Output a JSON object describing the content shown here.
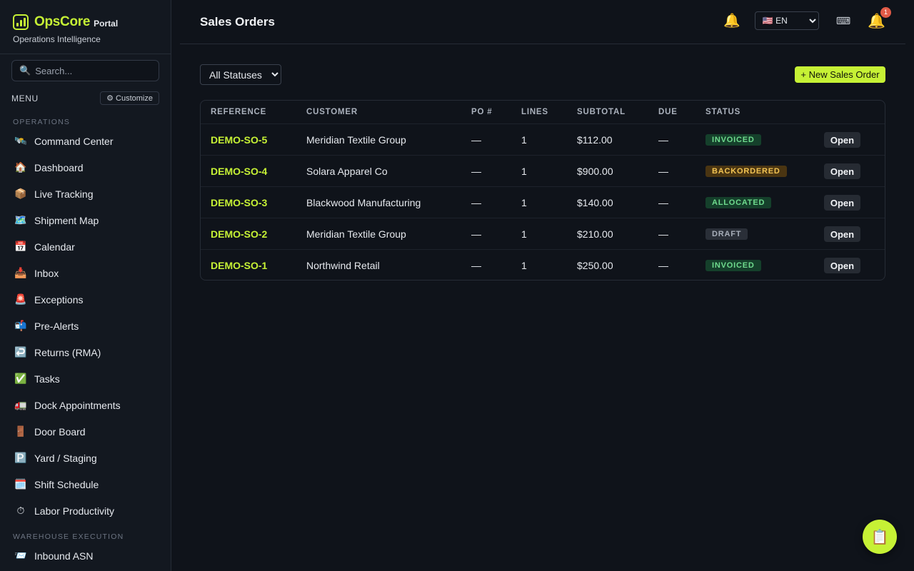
{
  "brand": {
    "name": "OpsCore",
    "portal": "Portal",
    "subtitle": "Operations Intelligence"
  },
  "search": {
    "placeholder": "Search..."
  },
  "menu": {
    "label": "MENU",
    "customize_label": "⚙ Customize"
  },
  "sections": [
    {
      "label": "OPERATIONS",
      "items": [
        {
          "label": "Command Center",
          "icon": "🛰️"
        },
        {
          "label": "Dashboard",
          "icon": "🏠"
        },
        {
          "label": "Live Tracking",
          "icon": "📦"
        },
        {
          "label": "Shipment Map",
          "icon": "🗺️"
        },
        {
          "label": "Calendar",
          "icon": "📅"
        },
        {
          "label": "Inbox",
          "icon": "📥"
        },
        {
          "label": "Exceptions",
          "icon": "🚨"
        },
        {
          "label": "Pre-Alerts",
          "icon": "📬"
        },
        {
          "label": "Returns (RMA)",
          "icon": "↩️"
        },
        {
          "label": "Tasks",
          "icon": "✅"
        },
        {
          "label": "Dock Appointments",
          "icon": "🚛"
        },
        {
          "label": "Door Board",
          "icon": "🚪"
        },
        {
          "label": "Yard / Staging",
          "icon": "🅿️"
        },
        {
          "label": "Shift Schedule",
          "icon": "🗓️"
        },
        {
          "label": "Labor Productivity",
          "icon": "⏱"
        }
      ]
    },
    {
      "label": "WAREHOUSE EXECUTION",
      "items": [
        {
          "label": "Inbound ASN",
          "icon": "📨"
        }
      ]
    }
  ],
  "header": {
    "title": "Sales Orders",
    "language": "🇺🇸 EN",
    "keyboard_icon": "⌨",
    "notification_count": "1"
  },
  "filter": {
    "selected": "All Statuses"
  },
  "new_button": {
    "label": "+ New Sales Order"
  },
  "table": {
    "columns": [
      "REFERENCE",
      "CUSTOMER",
      "PO #",
      "LINES",
      "SUBTOTAL",
      "DUE",
      "STATUS"
    ],
    "open_label": "Open",
    "rows": [
      {
        "reference": "DEMO-SO-5",
        "customer": "Meridian Textile Group",
        "po": "—",
        "lines": "1",
        "subtotal": "$112.00",
        "due": "—",
        "status": "INVOICED",
        "status_key": "invoiced"
      },
      {
        "reference": "DEMO-SO-4",
        "customer": "Solara Apparel Co",
        "po": "—",
        "lines": "1",
        "subtotal": "$900.00",
        "due": "—",
        "status": "BACKORDERED",
        "status_key": "backordered"
      },
      {
        "reference": "DEMO-SO-3",
        "customer": "Blackwood Manufacturing",
        "po": "—",
        "lines": "1",
        "subtotal": "$140.00",
        "due": "—",
        "status": "ALLOCATED",
        "status_key": "allocated"
      },
      {
        "reference": "DEMO-SO-2",
        "customer": "Meridian Textile Group",
        "po": "—",
        "lines": "1",
        "subtotal": "$210.00",
        "due": "—",
        "status": "DRAFT",
        "status_key": "draft"
      },
      {
        "reference": "DEMO-SO-1",
        "customer": "Northwind Retail",
        "po": "—",
        "lines": "1",
        "subtotal": "$250.00",
        "due": "—",
        "status": "INVOICED",
        "status_key": "invoiced"
      }
    ]
  },
  "fab": {
    "icon": "📋"
  },
  "colors": {
    "accent": "#c6f135",
    "background": "#0f131a",
    "sidebar": "#131820"
  }
}
